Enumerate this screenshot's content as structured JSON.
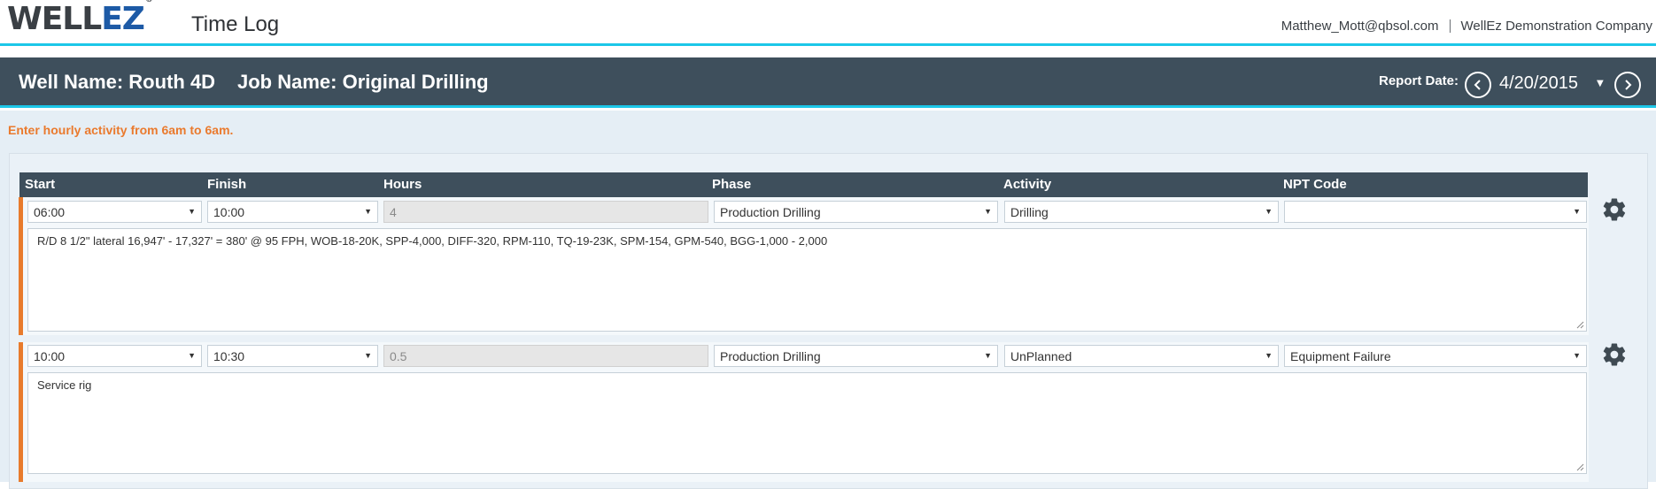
{
  "app": {
    "logo_main": "WELL",
    "logo_accent": "EZ",
    "logo_mark": "®",
    "title": "Time Log",
    "user_email": "Matthew_Mott@qbsol.com",
    "company": "WellEz Demonstration Company"
  },
  "header": {
    "well_name": "Well Name: Routh 4D",
    "job_name": "Job Name: Original Drilling",
    "report_date_label": "Report Date:",
    "report_date": "4/20/2015",
    "prev_icon": "chevron-left-icon",
    "next_icon": "chevron-right-icon"
  },
  "instructions": "Enter hourly activity from 6am to 6am.",
  "columns": {
    "start": "Start",
    "finish": "Finish",
    "hours": "Hours",
    "phase": "Phase",
    "activity": "Activity",
    "npt_code": "NPT Code"
  },
  "entries": [
    {
      "start": "06:00",
      "finish": "10:00",
      "hours": "4",
      "phase": "Production Drilling",
      "activity": "Drilling",
      "npt_code": "",
      "notes": "R/D 8 1/2\" lateral 16,947' - 17,327' = 380' @ 95 FPH, WOB-18-20K, SPP-4,000, DIFF-320, RPM-110, TQ-19-23K, SPM-154, GPM-540, BGG-1,000 - 2,000"
    },
    {
      "start": "10:00",
      "finish": "10:30",
      "hours": "0.5",
      "phase": "Production Drilling",
      "activity": "UnPlanned",
      "npt_code": "Equipment Failure",
      "notes": "Service rig"
    }
  ],
  "colors": {
    "header_bg": "#3e4f5c",
    "accent_cyan": "#1cc7e8",
    "accent_orange": "#e87b2c",
    "logo_blue": "#1d5aa6"
  }
}
